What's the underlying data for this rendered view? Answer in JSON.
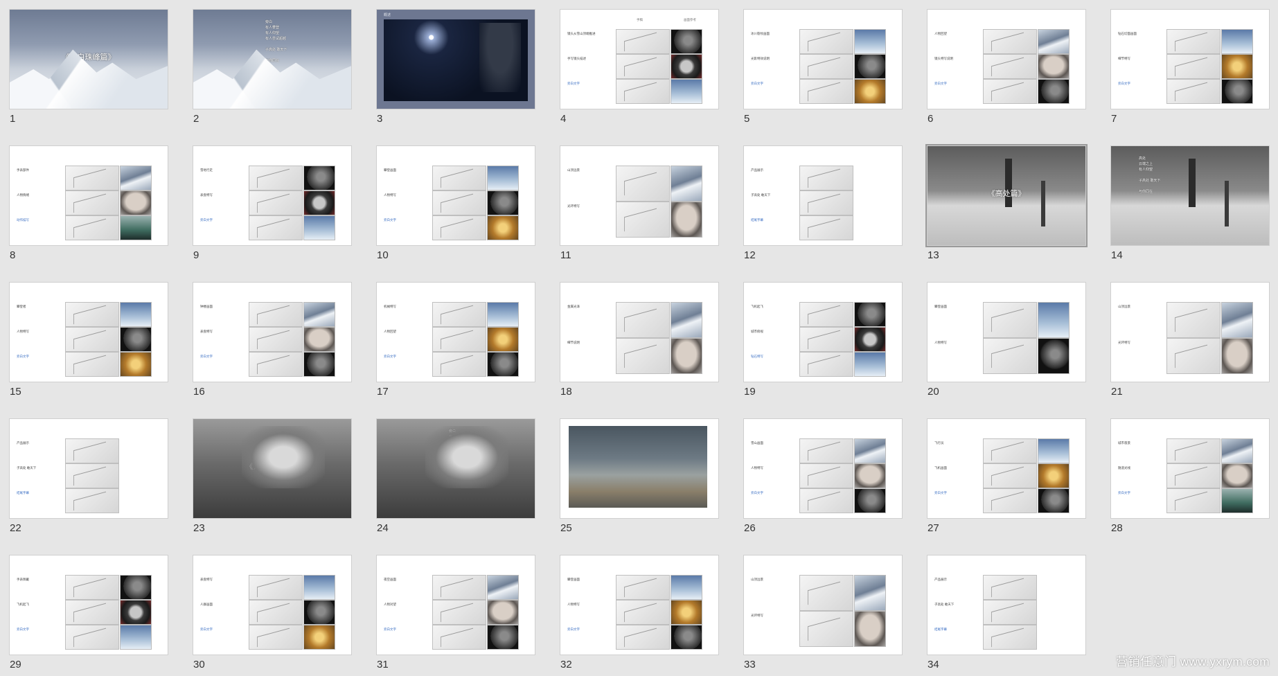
{
  "watermark": "营销任意门 www.yxrym.com",
  "slides": [
    {
      "num": "1",
      "title": "《顶白珠峰篇》"
    },
    {
      "num": "2",
      "lines": "旁白\n有人攀登\n有人仰望\n有人尝试超越\n\n子高处 敢天下\n\n与你同在"
    },
    {
      "num": "3",
      "caption": "概述"
    },
    {
      "num": "4",
      "h1": "手稿",
      "h2": "画面参考",
      "t1": "镜头从雪山顶端推进",
      "t2": "手写镜头描述",
      "t3": "旁白文字"
    },
    {
      "num": "5",
      "t1": "冰川裂纹画面",
      "t2": "光影特效说明",
      "t3": "旁白文字"
    },
    {
      "num": "6",
      "t1": "人物回望",
      "t2": "镜头特写说明",
      "t3": "旁白文字"
    },
    {
      "num": "7",
      "t1": "钻石切面画面",
      "t2": "细节特写",
      "t3": "旁白文字"
    },
    {
      "num": "8",
      "t1": "手表部件",
      "t2": "人物情绪",
      "t3": "动作描写"
    },
    {
      "num": "9",
      "t1": "雪地行走",
      "t2": "表盘特写",
      "t3": "旁白文字"
    },
    {
      "num": "10",
      "t1": "攀登画面",
      "t2": "人物特写",
      "t3": "旁白文字"
    },
    {
      "num": "11",
      "t1": "山顶远景",
      "t2": "光环特写"
    },
    {
      "num": "12",
      "t1": "产品展示",
      "t2": "子高处 敢天下",
      "t3": "结尾字幕"
    },
    {
      "num": "13",
      "title": "《高处篇》"
    },
    {
      "num": "14",
      "lines": "高处\n云端之上\n有人仰望\n\n子高处 敢天下\n\n与你同在"
    },
    {
      "num": "15",
      "t1": "攀登者",
      "t2": "人物特写",
      "t3": "旁白文字"
    },
    {
      "num": "16",
      "t1": "钟楼画面",
      "t2": "表盘特写",
      "t3": "旁白文字"
    },
    {
      "num": "17",
      "t1": "机械特写",
      "t2": "人物回望",
      "t3": "旁白文字"
    },
    {
      "num": "18",
      "t1": "金属光泽",
      "t2": "细节说明"
    },
    {
      "num": "19",
      "t1": "飞机起飞",
      "t2": "城市俯视",
      "t3": "钻石特写"
    },
    {
      "num": "20",
      "t1": "攀登画面",
      "t2": "人物特写"
    },
    {
      "num": "21",
      "t1": "山顶远景",
      "t2": "光环特写"
    },
    {
      "num": "22",
      "t1": "产品展示",
      "t2": "子高处 敢天下",
      "t3": "结尾字幕"
    },
    {
      "num": "23",
      "title": "《为高而生篇》"
    },
    {
      "num": "24",
      "lines": "旁白\n有人建造\n有人仰望\n\n子高处 敢天下\n\n与你同在"
    },
    {
      "num": "25"
    },
    {
      "num": "26",
      "t1": "雪山画面",
      "t2": "人物特写",
      "t3": "旁白文字"
    },
    {
      "num": "27",
      "t1": "飞行员",
      "t2": "飞机画面",
      "t3": "旁白文字"
    },
    {
      "num": "28",
      "t1": "城市夜景",
      "t2": "隧道光线",
      "t3": "旁白文字"
    },
    {
      "num": "29",
      "t1": "手表佩戴",
      "t2": "飞机起飞",
      "t3": "旁白文字"
    },
    {
      "num": "30",
      "t1": "表盘特写",
      "t2": "人群画面",
      "t3": "旁白文字"
    },
    {
      "num": "31",
      "t1": "夜空画面",
      "t2": "人物对望",
      "t3": "旁白文字"
    },
    {
      "num": "32",
      "t1": "攀登画面",
      "t2": "人物特写",
      "t3": "旁白文字"
    },
    {
      "num": "33",
      "t1": "山顶远景",
      "t2": "光环特写"
    },
    {
      "num": "34",
      "t1": "产品展示",
      "t2": "子高处 敢天下",
      "t3": "结尾字幕"
    }
  ]
}
